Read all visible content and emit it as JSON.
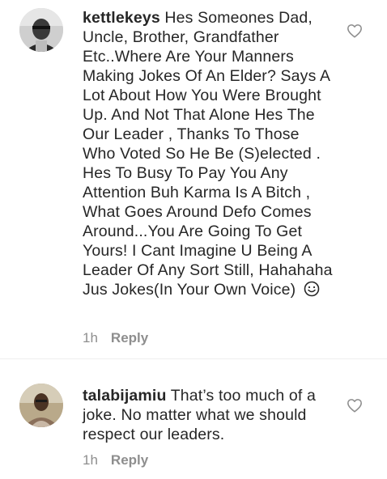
{
  "comments": [
    {
      "username": "kettlekeys",
      "text": "Hes Someones Dad, Uncle, Brother, Grandfather Etc..Where Are Your Manners Making Jokes Of An Elder? Says A Lot About How You Were Brought Up. And Not That Alone Hes The Our Leader , Thanks To Those Who Voted So He Be (S)elected . Hes To Busy To Pay You Any Attention Buh Karma Is A Bitch , What Goes Around Defo Comes Around...You Are Going To Get Yours! I Cant Imagine U Being A Leader Of Any Sort Still, Hahahaha Jus Jokes(In Your Own Voice)",
      "emoji_icon": "smiley-face-icon",
      "time": "1h",
      "reply_label": "Reply",
      "like_icon": "heart-outline-icon"
    },
    {
      "username": "talabijamiu",
      "text": "That’s too much of a joke.  No matter what we should respect our leaders.",
      "time": "1h",
      "reply_label": "Reply",
      "like_icon": "heart-outline-icon"
    }
  ],
  "colors": {
    "text": "#262626",
    "muted": "#8e8e8e",
    "background": "#ffffff"
  }
}
